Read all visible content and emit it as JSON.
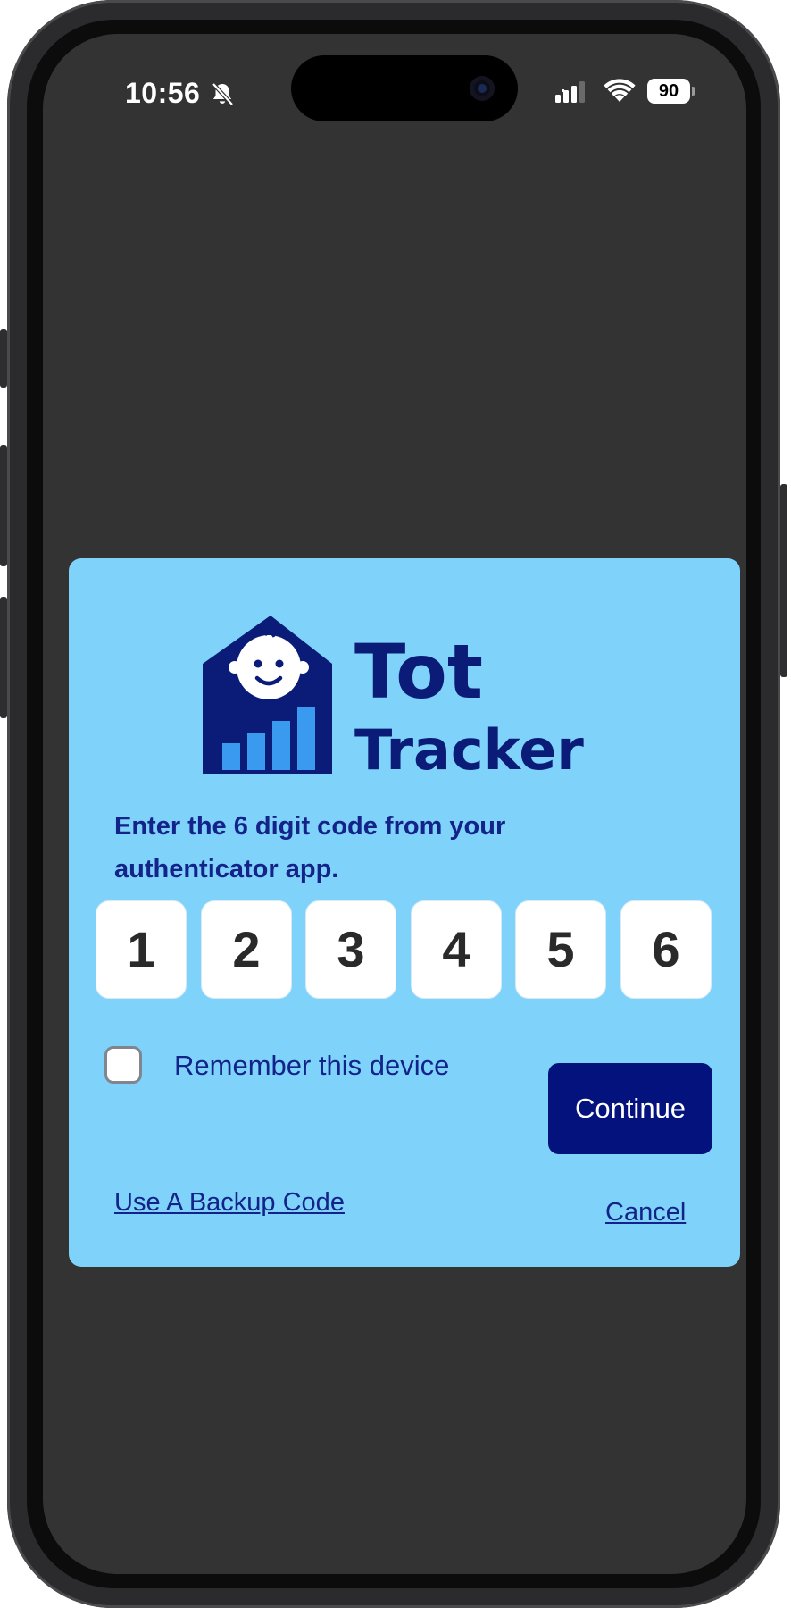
{
  "status_bar": {
    "time": "10:56",
    "battery": "90",
    "icons": [
      "bell-slash-icon",
      "cellular-signal-icon",
      "wifi-icon",
      "battery-icon"
    ]
  },
  "logo": {
    "line1": "Tot",
    "line2": "Tracker",
    "colors": {
      "navy": "#0b1c78",
      "blue": "#3a9af0"
    }
  },
  "dialog": {
    "instructions": "Enter the 6 digit code from your authenticator app.",
    "code_digits": [
      "1",
      "2",
      "3",
      "4",
      "5",
      "6"
    ],
    "remember_label": "Remember this device",
    "remember_checked": false,
    "continue_label": "Continue",
    "backup_link": "Use A Backup Code",
    "cancel_link": "Cancel"
  },
  "colors": {
    "card_background": "#7fd3fa",
    "text_primary": "#13238a",
    "button_primary": "#04127e",
    "screen_background": "#333333"
  }
}
